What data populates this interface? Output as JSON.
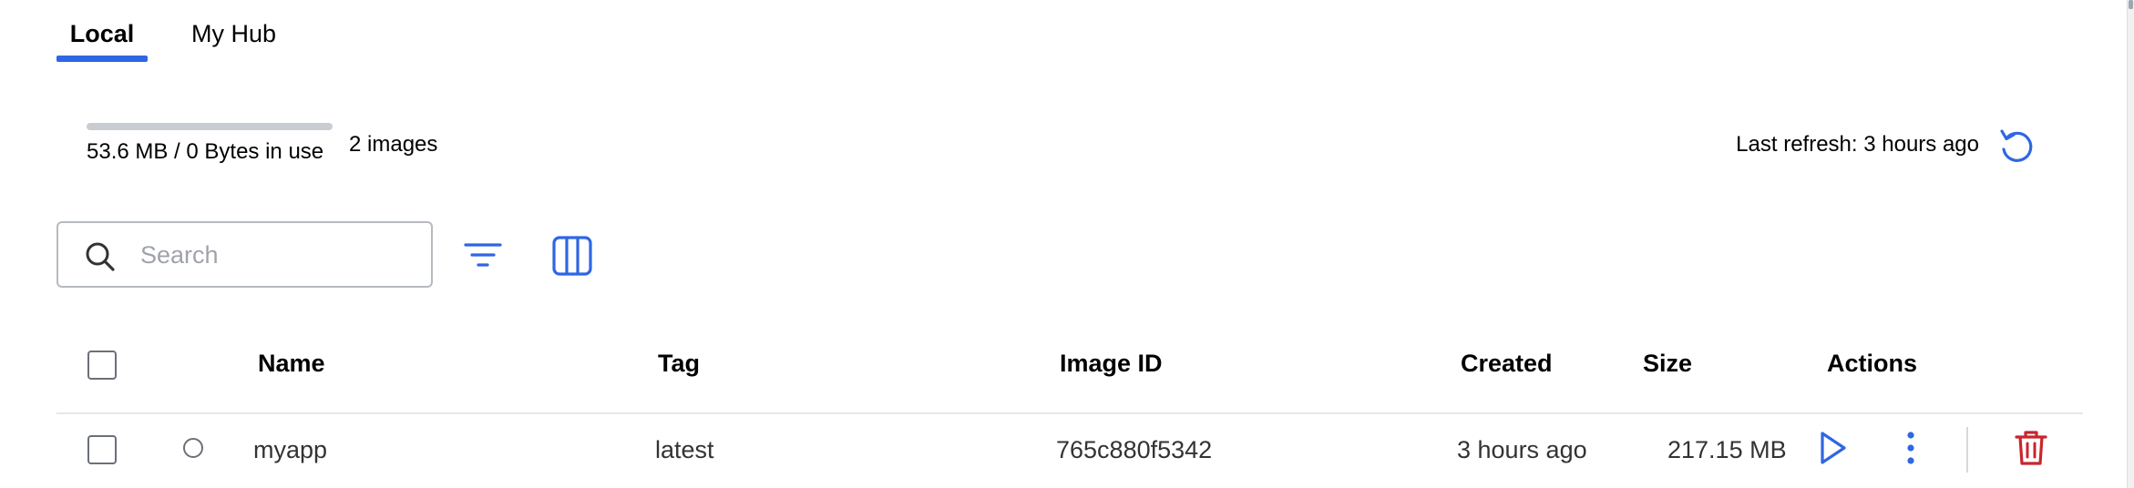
{
  "tabs": [
    {
      "label": "Local",
      "active": true
    },
    {
      "label": "My Hub",
      "active": false
    }
  ],
  "usage": {
    "text": "53.6 MB / 0 Bytes in use",
    "image_count": "2 images"
  },
  "refresh": {
    "text": "Last refresh: 3 hours ago",
    "icon": "refresh-icon"
  },
  "search": {
    "placeholder": "Search",
    "value": ""
  },
  "toolbar": {
    "filter_icon": "filter-icon",
    "columns_icon": "columns-icon"
  },
  "table": {
    "columns": [
      "Name",
      "Tag",
      "Image ID",
      "Created",
      "Size",
      "Actions"
    ],
    "rows": [
      {
        "name": "myapp",
        "tag": "latest",
        "image_id": "765c880f5342",
        "created": "3 hours ago",
        "size": "217.15 MB",
        "actions": [
          "run-icon",
          "more-options-icon",
          "delete-icon"
        ]
      }
    ]
  },
  "colors": {
    "accent": "#2f66e3",
    "danger": "#c8262d",
    "text": "#000000",
    "muted": "#a0a4aa",
    "border": "#b6bac0"
  }
}
